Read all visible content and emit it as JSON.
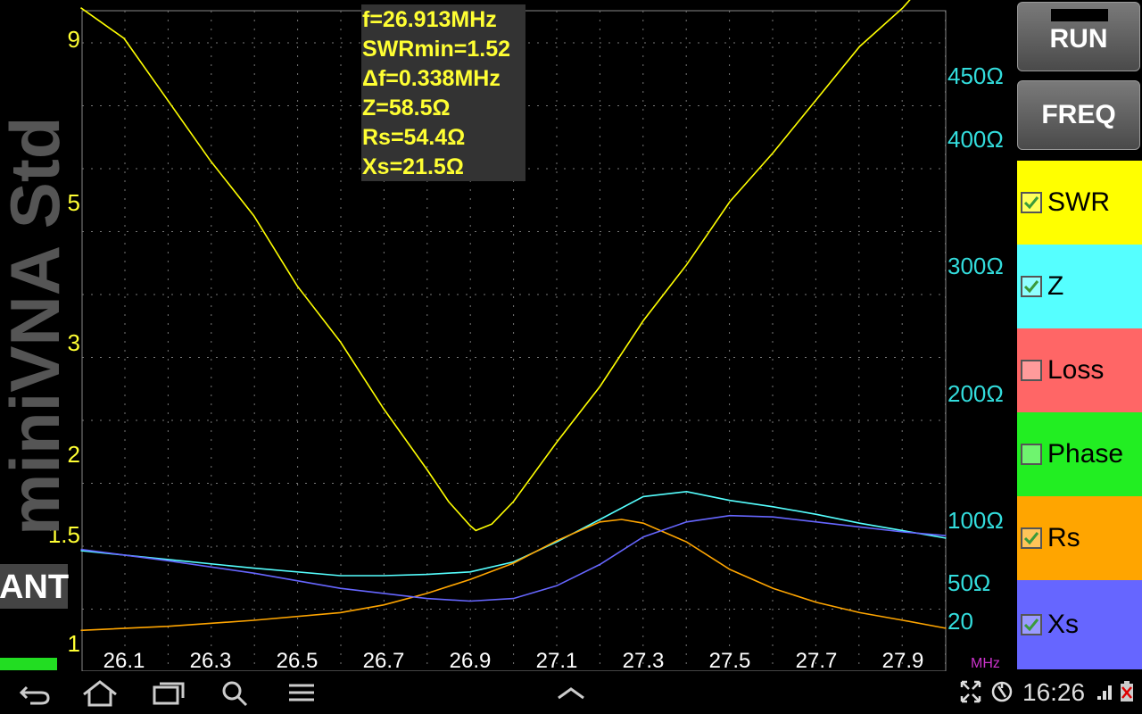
{
  "app": {
    "brand": "miniVNA Std",
    "mode_button": "ANT"
  },
  "readout": [
    "f=26.913MHz",
    "SWRmin=1.52",
    "Δf=0.338MHz",
    "Z=58.5Ω",
    "Rs=54.4Ω",
    "Xs=21.5Ω"
  ],
  "left_axis_ticks": [
    {
      "label": "9",
      "value": 9
    },
    {
      "label": "5",
      "value": 5
    },
    {
      "label": "3",
      "value": 3
    },
    {
      "label": "2",
      "value": 2
    },
    {
      "label": "1.5",
      "value": 1.5
    },
    {
      "label": "1",
      "value": 1
    }
  ],
  "right_axis_ticks": [
    {
      "label": "450Ω",
      "value": 450
    },
    {
      "label": "400Ω",
      "value": 400
    },
    {
      "label": "300Ω",
      "value": 300
    },
    {
      "label": "200Ω",
      "value": 200
    },
    {
      "label": "100Ω",
      "value": 100
    },
    {
      "label": "50Ω",
      "value": 50
    },
    {
      "label": "20",
      "value": 20
    }
  ],
  "x_axis_ticks": [
    "26.1",
    "26.3",
    "26.5",
    "26.7",
    "26.9",
    "27.1",
    "27.3",
    "27.5",
    "27.7",
    "27.9"
  ],
  "x_unit": "MHz",
  "buttons": {
    "run": "RUN",
    "freq": "FREQ"
  },
  "toggles": [
    {
      "label": "SWR",
      "checked": true,
      "color": "#ffff00"
    },
    {
      "label": "Z",
      "checked": true,
      "color": "#55ffff"
    },
    {
      "label": "Loss",
      "checked": false,
      "color": "#ff6666"
    },
    {
      "label": "Phase",
      "checked": false,
      "color": "#22ee22"
    },
    {
      "label": "Rs",
      "checked": true,
      "color": "#ffa500"
    },
    {
      "label": "Xs",
      "checked": true,
      "color": "#6666ff"
    }
  ],
  "statusbar": {
    "time": "16:26"
  },
  "chart_data": {
    "type": "line",
    "x_unit": "MHz",
    "xlim": [
      26.0,
      28.0
    ],
    "y_left_ticks": [
      1,
      1.5,
      2,
      3,
      5,
      9
    ],
    "y_right_ticks": [
      20,
      50,
      100,
      200,
      300,
      400,
      450
    ],
    "grid": true,
    "series": [
      {
        "name": "SWR",
        "color": "#ffff00",
        "axis": "left",
        "x": [
          26.0,
          26.1,
          26.2,
          26.3,
          26.4,
          26.5,
          26.6,
          26.7,
          26.8,
          26.85,
          26.9,
          26.913,
          26.95,
          27.0,
          27.1,
          27.2,
          27.3,
          27.4,
          27.5,
          27.6,
          27.7,
          27.8,
          27.9,
          27.95,
          28.0
        ],
        "y": [
          10,
          9,
          7.5,
          6,
          4.8,
          3.8,
          3.0,
          2.4,
          1.9,
          1.7,
          1.55,
          1.52,
          1.56,
          1.7,
          2.1,
          2.6,
          3.3,
          4.1,
          5.0,
          6.2,
          7.5,
          8.8,
          10,
          10.8,
          11.6
        ]
      },
      {
        "name": "Z",
        "color": "#55ffff",
        "axis": "right",
        "x": [
          26.0,
          26.2,
          26.4,
          26.6,
          26.7,
          26.8,
          26.9,
          27.0,
          27.1,
          27.2,
          27.3,
          27.4,
          27.5,
          27.6,
          27.7,
          27.8,
          27.9,
          28.0
        ],
        "y": [
          75,
          68,
          61,
          55,
          55,
          56,
          58,
          66,
          82,
          100,
          118,
          122,
          115,
          110,
          104,
          97,
          91,
          85
        ]
      },
      {
        "name": "Rs",
        "color": "#ffa500",
        "axis": "right",
        "x": [
          26.0,
          26.2,
          26.4,
          26.6,
          26.7,
          26.8,
          26.9,
          27.0,
          27.1,
          27.2,
          27.25,
          27.3,
          27.4,
          27.5,
          27.6,
          27.7,
          27.8,
          27.9,
          28.0
        ],
        "y": [
          15,
          17,
          20,
          26,
          32,
          41,
          52,
          65,
          83,
          98,
          100,
          97,
          82,
          60,
          45,
          34,
          26,
          20,
          16
        ]
      },
      {
        "name": "Xs",
        "color": "#6666ff",
        "axis": "right",
        "x": [
          26.0,
          26.2,
          26.4,
          26.6,
          26.8,
          26.9,
          27.0,
          27.1,
          27.2,
          27.3,
          27.4,
          27.5,
          27.6,
          27.7,
          27.8,
          27.9,
          28.0
        ],
        "y": [
          76,
          67,
          57,
          45,
          37,
          35,
          37,
          47,
          64,
          86,
          98,
          103,
          102,
          98,
          94,
          90,
          87
        ]
      }
    ]
  }
}
